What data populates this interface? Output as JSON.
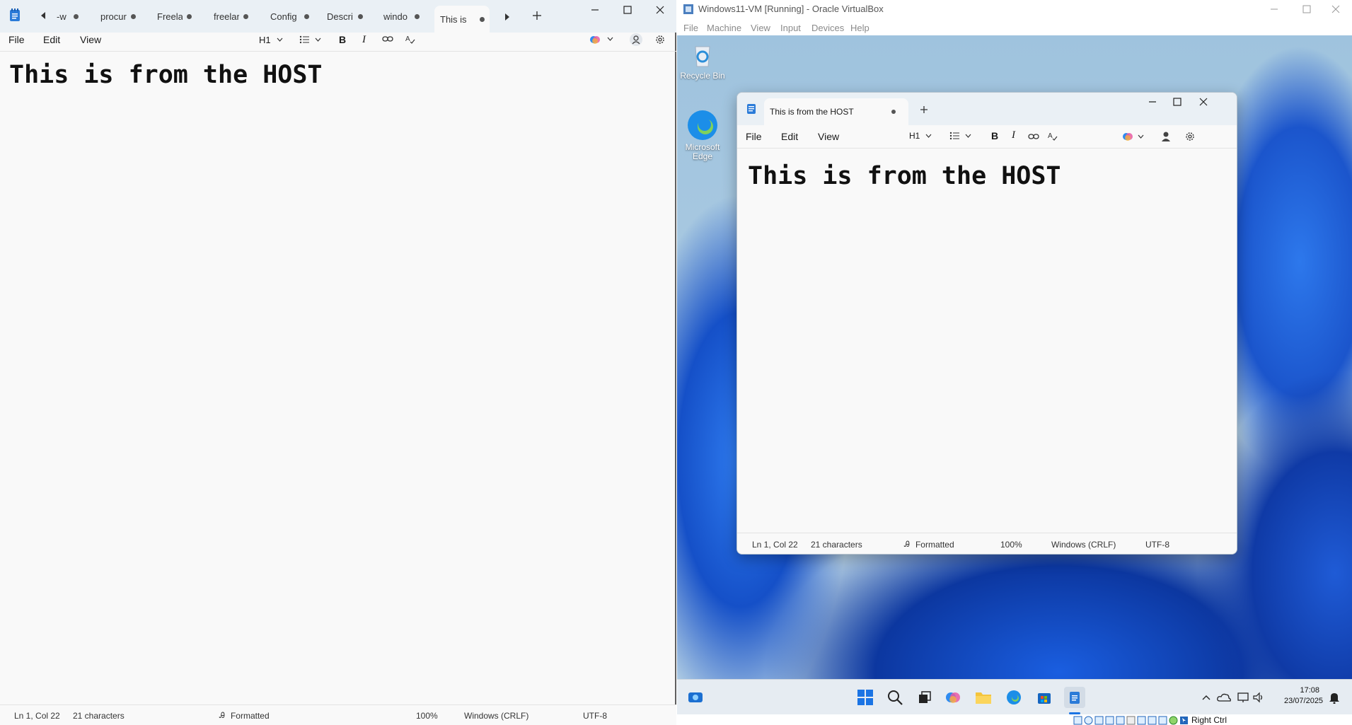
{
  "host": {
    "tabs": [
      {
        "label": "-w"
      },
      {
        "label": "procur"
      },
      {
        "label": "Freelar"
      },
      {
        "label": "freelar"
      },
      {
        "label": "Config"
      },
      {
        "label": "Descri"
      },
      {
        "label": "windo"
      },
      {
        "label": "This is"
      }
    ],
    "menu": {
      "file": "File",
      "edit": "Edit",
      "view": "View"
    },
    "toolbar": {
      "heading": "H1",
      "bold": "B",
      "italic": "I"
    },
    "content": {
      "heading": "This is from the HOST"
    },
    "status": {
      "position": "Ln 1, Col 22",
      "chars": "21 characters",
      "format": "Formatted",
      "zoom": "100%",
      "line_ending": "Windows (CRLF)",
      "encoding": "UTF-8"
    }
  },
  "vbox": {
    "title": "Windows11-VM [Running] - Oracle VirtualBox",
    "menu": [
      "File",
      "Machine",
      "View",
      "Input",
      "Devices",
      "Help"
    ],
    "desktop_icons": [
      {
        "label": "Recycle Bin",
        "icon": "recycle-bin-icon"
      },
      {
        "label": "Microsoft Edge",
        "icon": "edge-icon"
      }
    ],
    "guest_notepad": {
      "tab_label": "This is from the HOST",
      "menu": {
        "file": "File",
        "edit": "Edit",
        "view": "View"
      },
      "toolbar": {
        "heading": "H1",
        "bold": "B",
        "italic": "I"
      },
      "content": {
        "heading": "This is from the HOST"
      },
      "status": {
        "position": "Ln 1, Col 22",
        "chars": "21 characters",
        "format": "Formatted",
        "zoom": "100%",
        "line_ending": "Windows (CRLF)",
        "encoding": "UTF-8"
      }
    },
    "taskbar": {
      "time": "17:08",
      "date": "23/07/2025"
    },
    "host_key": "Right Ctrl"
  },
  "colors": {
    "accent_blue": "#0f5bd6",
    "titlebar": "#eaf0f5",
    "editor_bg": "#f9f9f9"
  }
}
